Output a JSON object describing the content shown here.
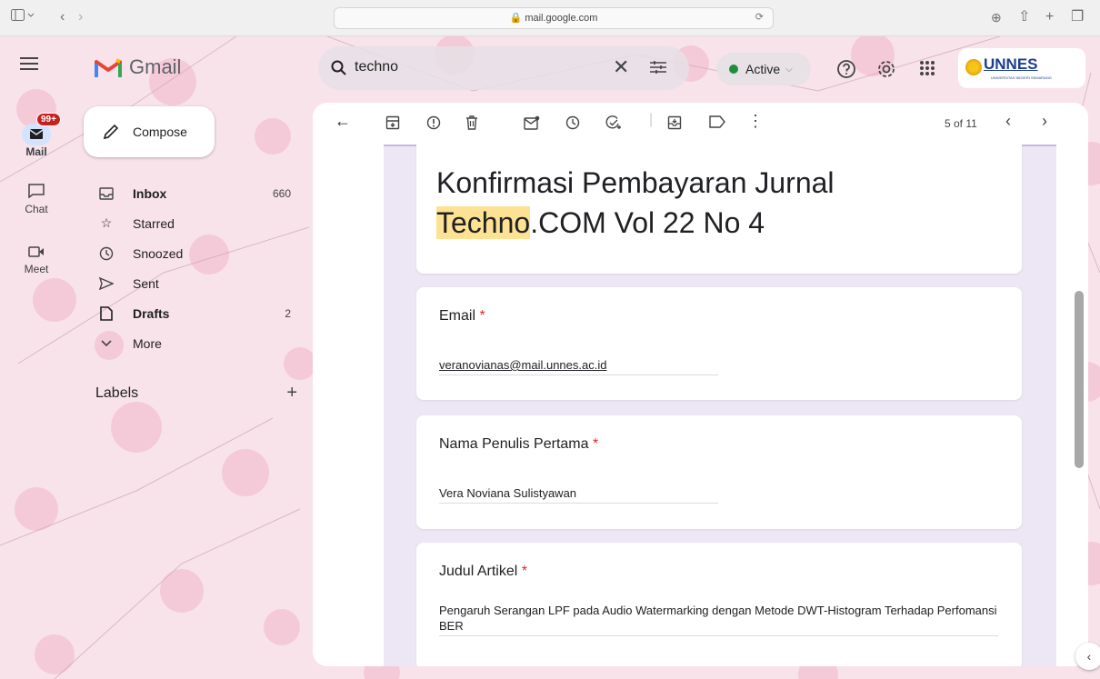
{
  "browser": {
    "url": "mail.google.com"
  },
  "app": {
    "name": "Gmail"
  },
  "rail": {
    "mail_badge": "99+",
    "items": [
      {
        "label": "Mail",
        "icon": "mail-icon"
      },
      {
        "label": "Chat",
        "icon": "chat-icon"
      },
      {
        "label": "Meet",
        "icon": "meet-icon"
      }
    ]
  },
  "compose": {
    "label": "Compose"
  },
  "nav": {
    "items": [
      {
        "label": "Inbox",
        "count": "660",
        "icon": "inbox-icon",
        "bold": true
      },
      {
        "label": "Starred",
        "count": "",
        "icon": "star-icon",
        "bold": false
      },
      {
        "label": "Snoozed",
        "count": "",
        "icon": "clock-icon",
        "bold": false
      },
      {
        "label": "Sent",
        "count": "",
        "icon": "send-icon",
        "bold": false
      },
      {
        "label": "Drafts",
        "count": "2",
        "icon": "draft-icon",
        "bold": true
      },
      {
        "label": "More",
        "count": "",
        "icon": "chevron-down-icon",
        "bold": false
      }
    ],
    "labels_heading": "Labels",
    "labels_add": "+"
  },
  "search": {
    "query": "techno",
    "clear": "✕"
  },
  "status": {
    "label": "Active",
    "color": "#1e8e3e"
  },
  "account": {
    "org": "UNNES",
    "org_sub": "UNIVERSITAS NEGERI SEMARANG"
  },
  "toolbar": {
    "pagination": "5 of 11"
  },
  "form": {
    "title_highlight": "Techno",
    "title_pre": "Konfirmasi Pembayaran Jurnal ",
    "title_post": ".COM Vol 22 No 4",
    "required_mark": "*",
    "fields": [
      {
        "question": "Email",
        "answer": "veranovianas@mail.unnes.ac.id"
      },
      {
        "question": "Nama Penulis Pertama",
        "answer": "Vera Noviana Sulistyawan"
      },
      {
        "question": "Judul Artikel",
        "answer": "Pengaruh Serangan LPF pada Audio Watermarking dengan Metode DWT-Histogram Terhadap Perfomansi BER"
      }
    ]
  },
  "colors": {
    "highlight": "#fde293",
    "form_bg": "#ede7f5",
    "required": "#d93025"
  }
}
